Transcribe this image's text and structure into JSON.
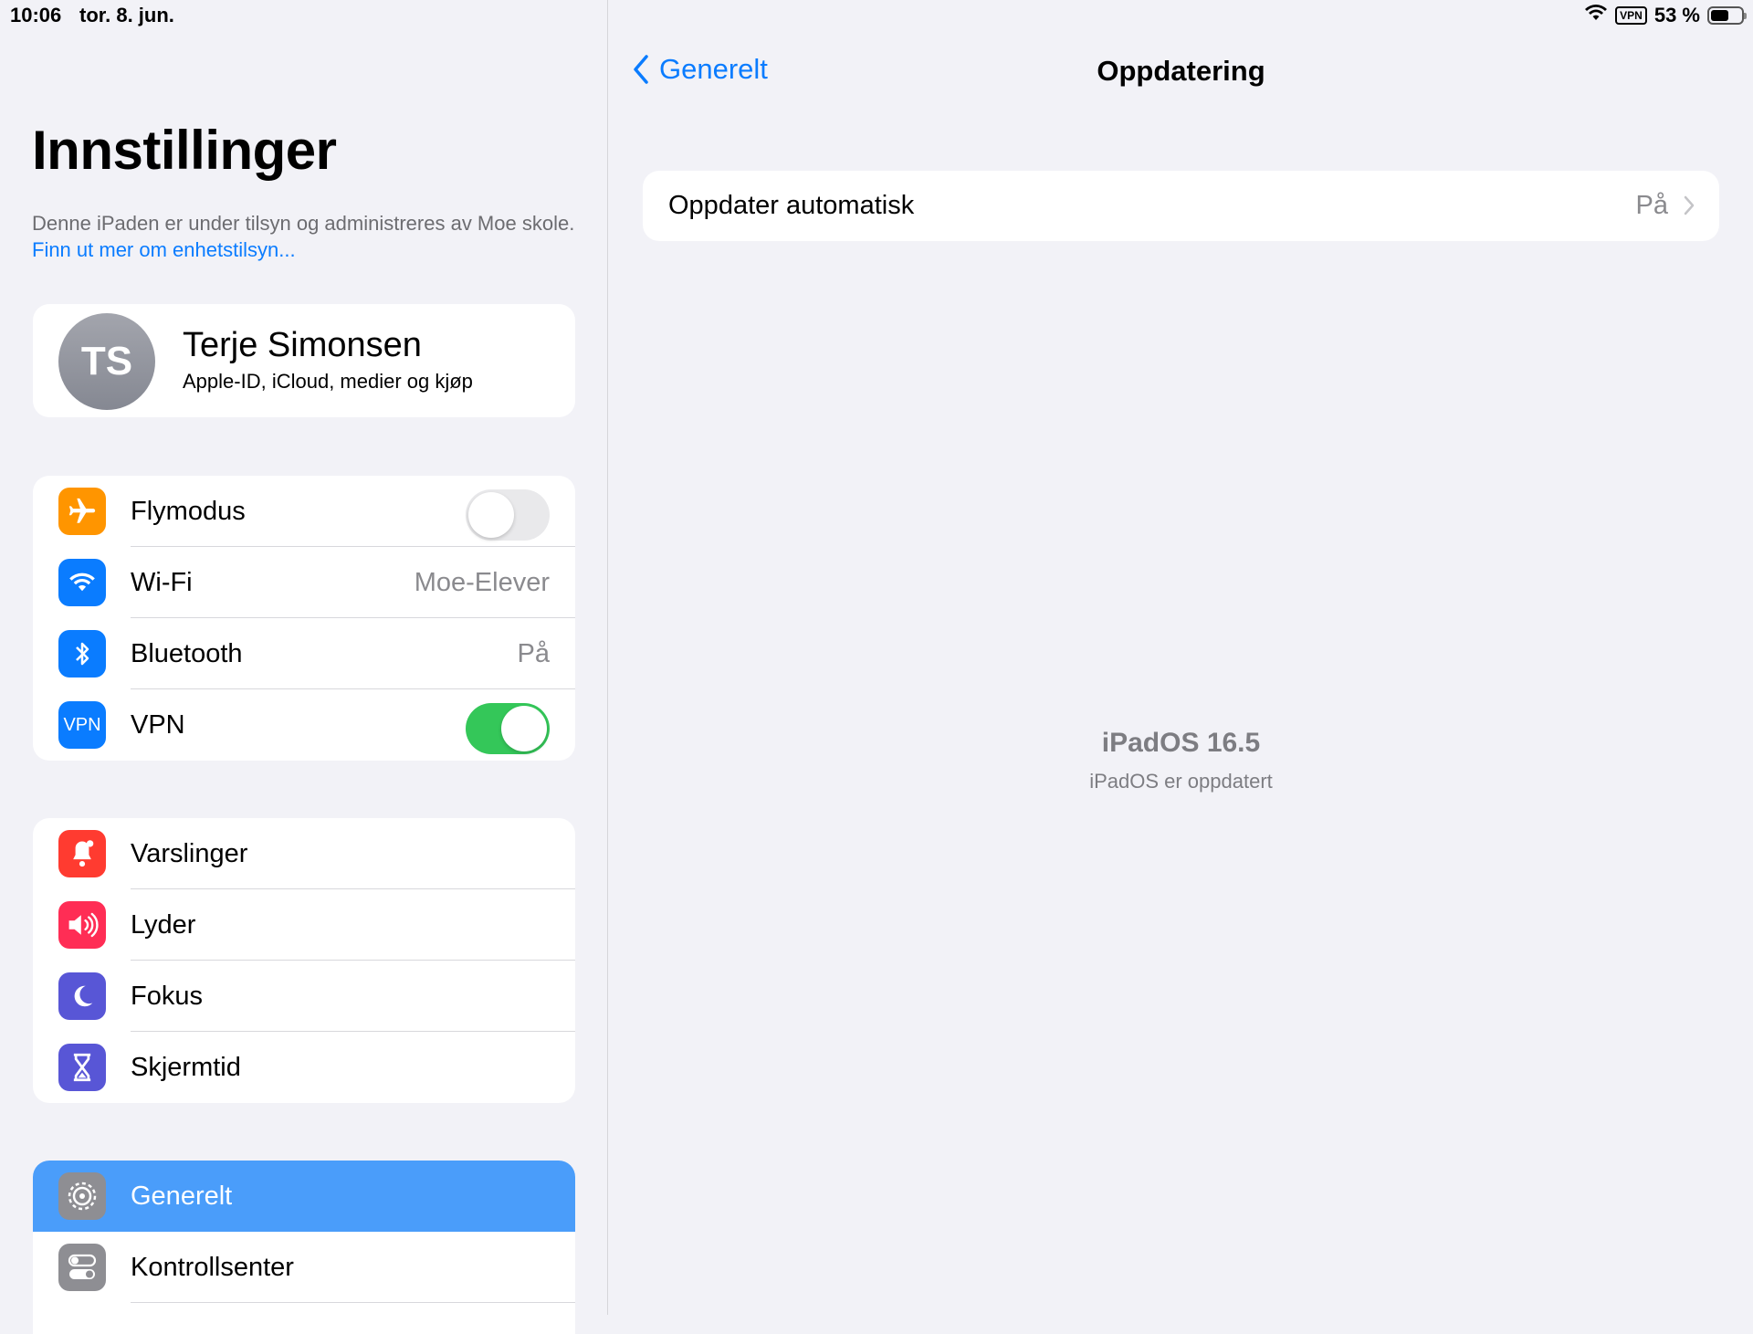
{
  "status_bar": {
    "time": "10:06",
    "date": "tor. 8. jun.",
    "vpn": "VPN",
    "battery": "53 %",
    "battery_level": 0.53
  },
  "sidebar": {
    "title": "Innstillinger",
    "supervision_text": "Denne iPaden er under tilsyn og administreres av Moe skole.",
    "supervision_link": "Finn ut mer om enhetstilsyn...",
    "profile": {
      "initials": "TS",
      "name": "Terje Simonsen",
      "subtitle": "Apple-ID, iCloud, medier og kjøp"
    },
    "group1": [
      {
        "label": "Flymodus",
        "icon": "airplane-icon",
        "color": "#ff9500",
        "toggle": false
      },
      {
        "label": "Wi-Fi",
        "icon": "wifi-icon",
        "color": "#0a7cff",
        "value": "Moe-Elever"
      },
      {
        "label": "Bluetooth",
        "icon": "bluetooth-icon",
        "color": "#0a7cff",
        "value": "På"
      },
      {
        "label": "VPN",
        "icon": "vpn-icon",
        "color": "#0a7cff",
        "toggle": true
      }
    ],
    "group2": [
      {
        "label": "Varslinger",
        "icon": "bell-icon",
        "color": "#ff3b30"
      },
      {
        "label": "Lyder",
        "icon": "speaker-icon",
        "color": "#ff2d55"
      },
      {
        "label": "Fokus",
        "icon": "moon-icon",
        "color": "#5856d6"
      },
      {
        "label": "Skjermtid",
        "icon": "hourglass-icon",
        "color": "#5856d6"
      }
    ],
    "group3": [
      {
        "label": "Generelt",
        "icon": "gear-icon",
        "color": "#8e8e93",
        "selected": true
      },
      {
        "label": "Kontrollsenter",
        "icon": "switches-icon",
        "color": "#8e8e93"
      }
    ]
  },
  "detail": {
    "back_label": "Generelt",
    "title": "Oppdatering",
    "auto_update": {
      "label": "Oppdater automatisk",
      "value": "På"
    },
    "os_version": "iPadOS 16.5",
    "os_status": "iPadOS er oppdatert"
  },
  "colors": {
    "accent": "#0a7cff",
    "selected": "#4a9dfa",
    "toggle_on": "#34c759",
    "background": "#f2f2f7"
  }
}
